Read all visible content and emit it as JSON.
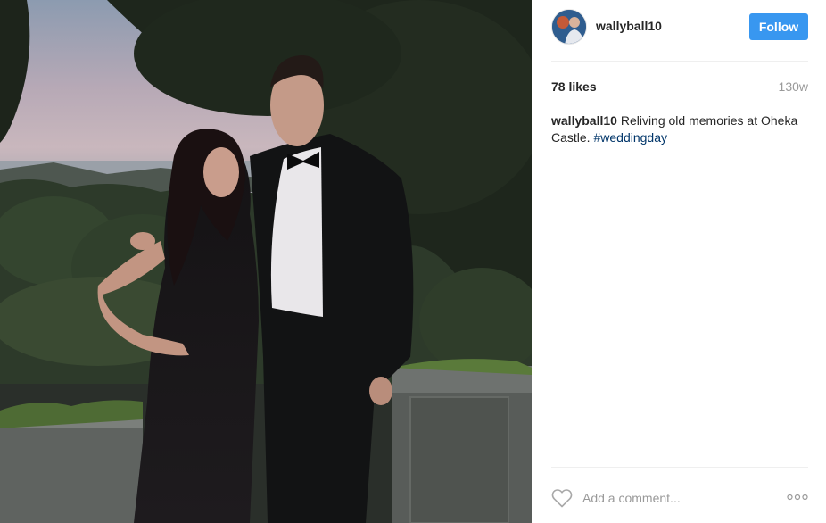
{
  "post": {
    "username": "wallyball10",
    "follow_label": "Follow",
    "likes": "78 likes",
    "time": "130w",
    "caption": {
      "user": "wallyball10",
      "text_before": " Reliving old memories at Oheka Castle. ",
      "hashtag": "#weddingday"
    },
    "comment_placeholder": "Add a comment...",
    "accent_color": "#3897f0",
    "hashtag_color": "#003569"
  },
  "icons": {
    "heart": "heart-icon",
    "more": "more-options-icon"
  }
}
